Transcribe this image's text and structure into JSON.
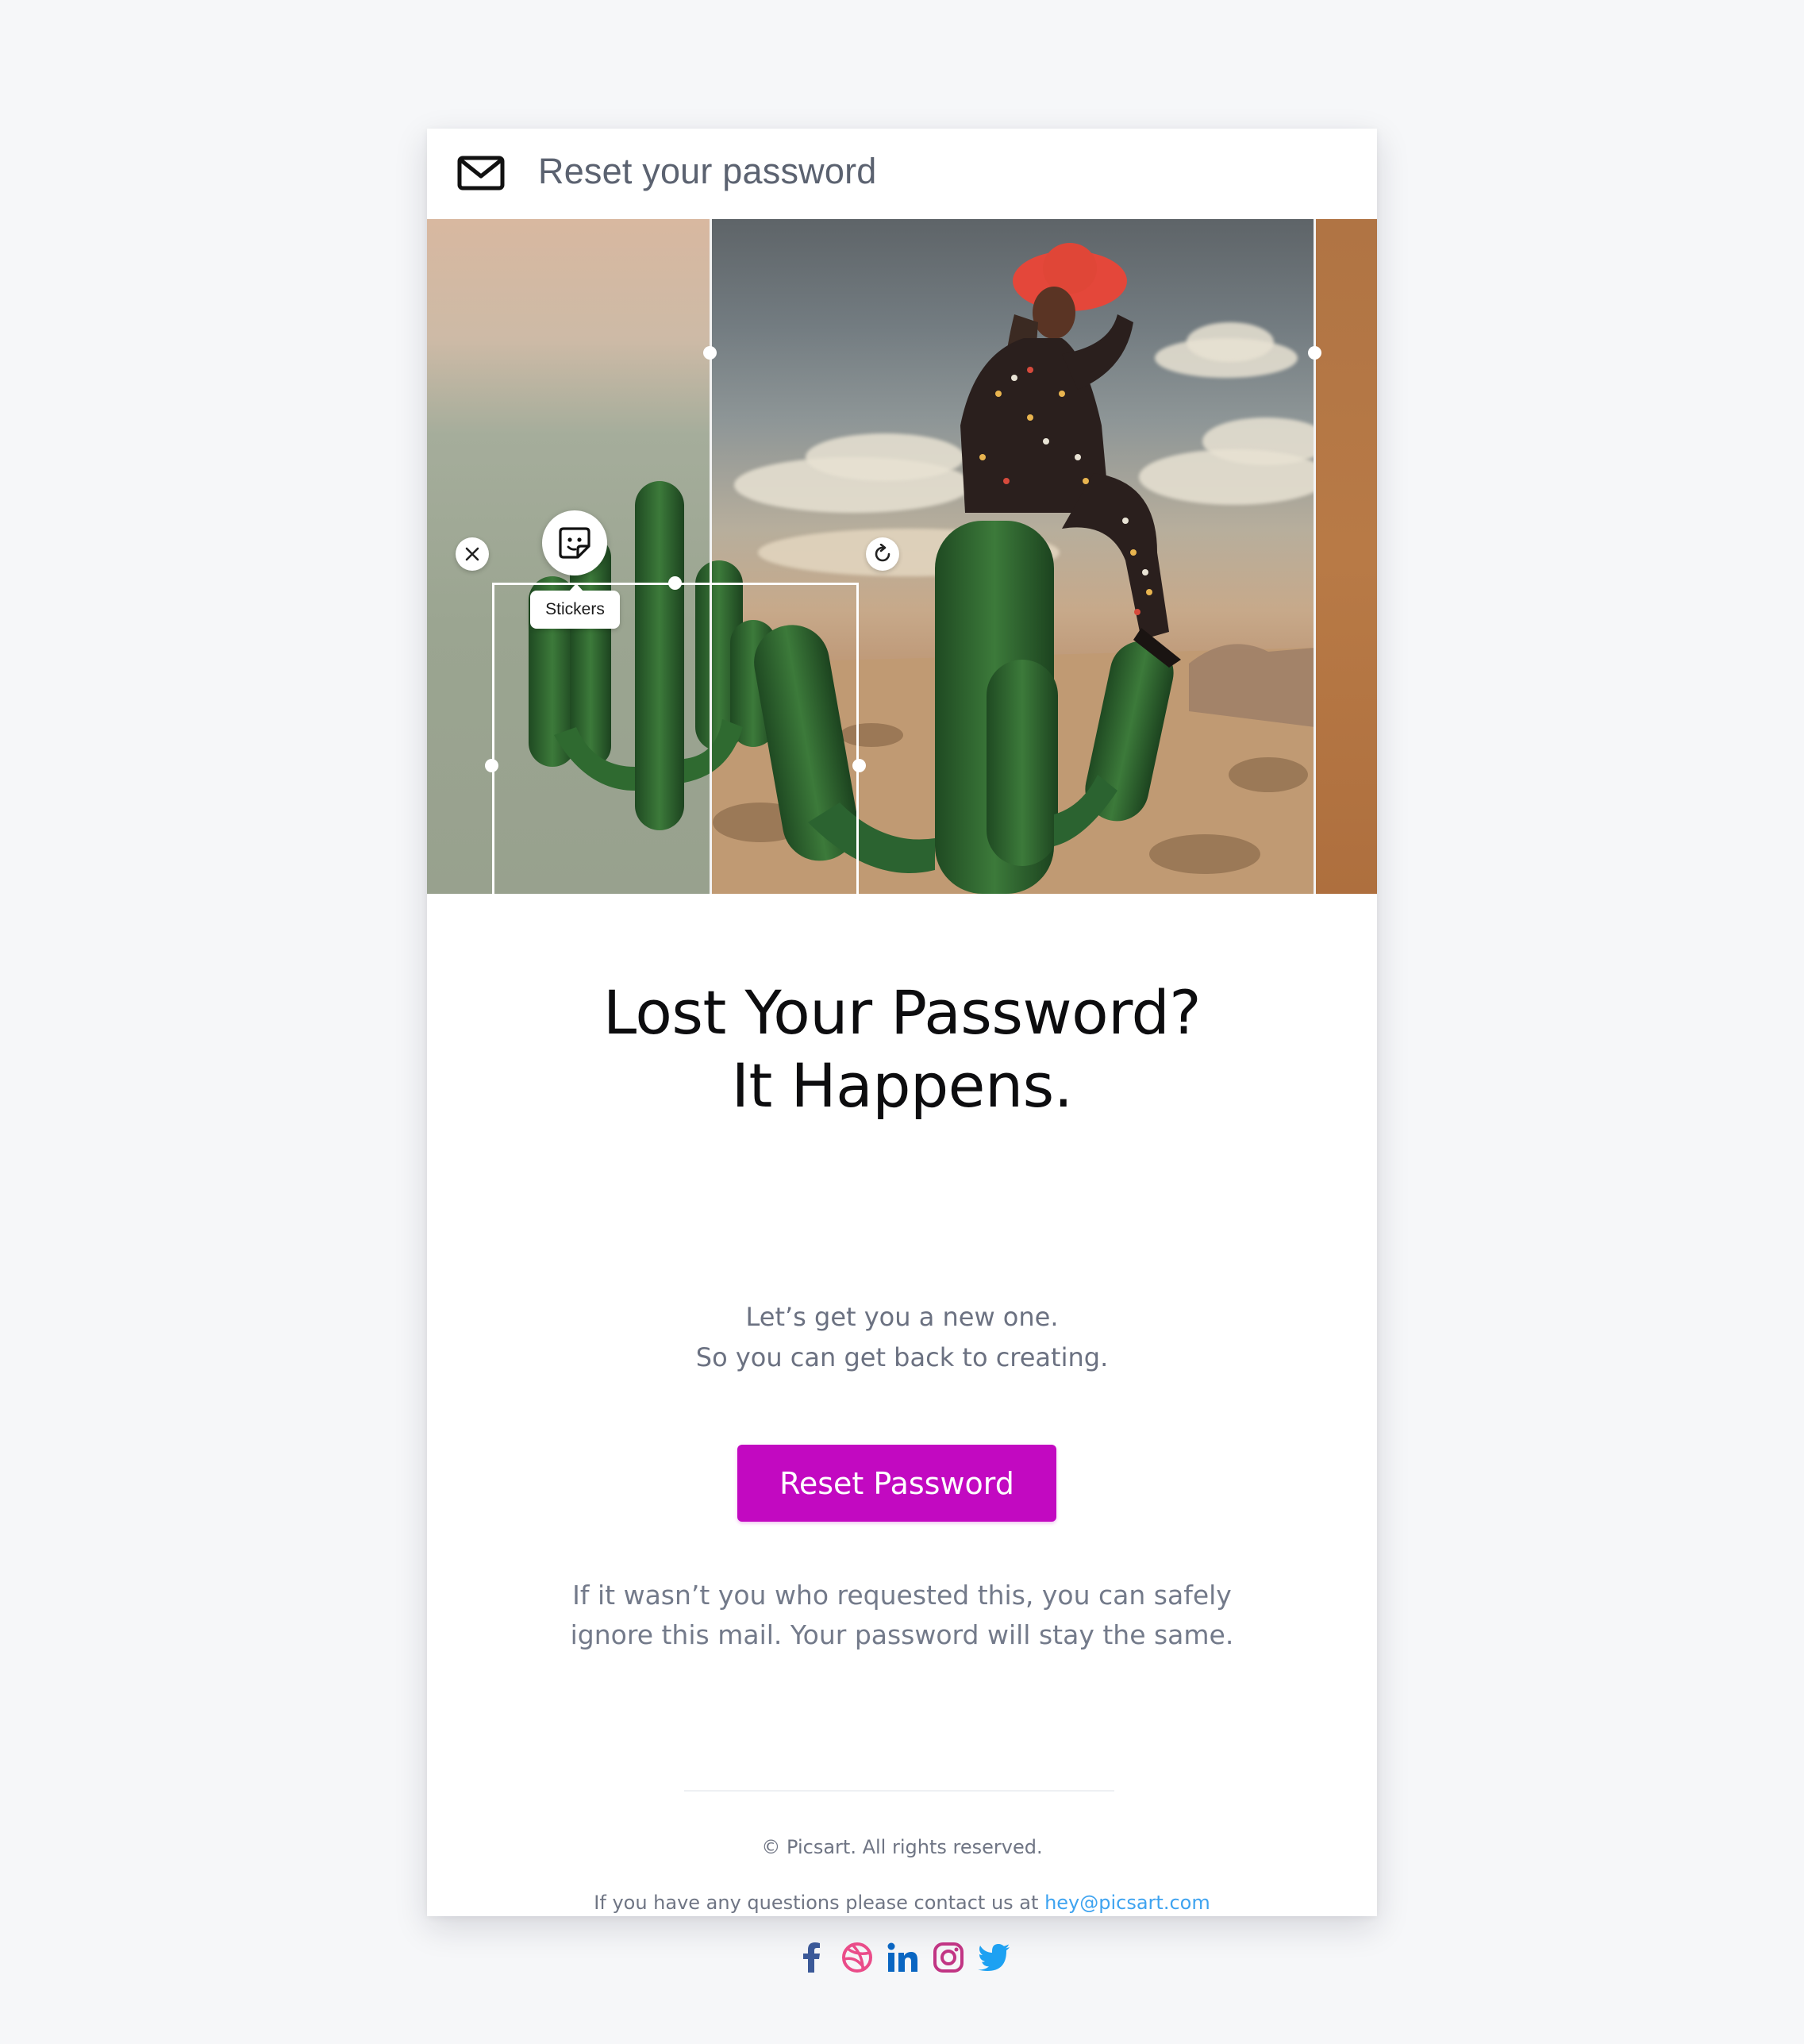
{
  "email": {
    "subject": "Reset your password",
    "headline": [
      "Lost Your Password?",
      "It Happens."
    ],
    "subline": [
      "Let’s get you a new one.",
      "So you can get back to creating."
    ],
    "cta_label": "Reset Password",
    "note": [
      "If it wasn’t you who requested this, you can safely",
      "ignore this mail. Your password will stay the same."
    ],
    "copyright": "© Picsart. All rights reserved.",
    "contact_text": "If you have any questions please contact us at ",
    "contact_email": "hey@picsart.com"
  },
  "editor": {
    "tooltip": "Stickers",
    "icons": [
      "mail-icon",
      "close-icon",
      "sticker-icon",
      "rotate-icon",
      "resize-icon"
    ]
  },
  "socials": [
    {
      "name": "facebook-icon",
      "color": "#3b5998"
    },
    {
      "name": "dribbble-icon",
      "color": "#ea4c89"
    },
    {
      "name": "linkedin-icon",
      "color": "#0a66c2"
    },
    {
      "name": "instagram-icon",
      "color": "#c13584"
    },
    {
      "name": "twitter-icon",
      "color": "#1da1f2"
    }
  ],
  "colors": {
    "accent": "#c209c1",
    "link": "#3ea3f0",
    "page_bg": "#f6f7f9"
  }
}
